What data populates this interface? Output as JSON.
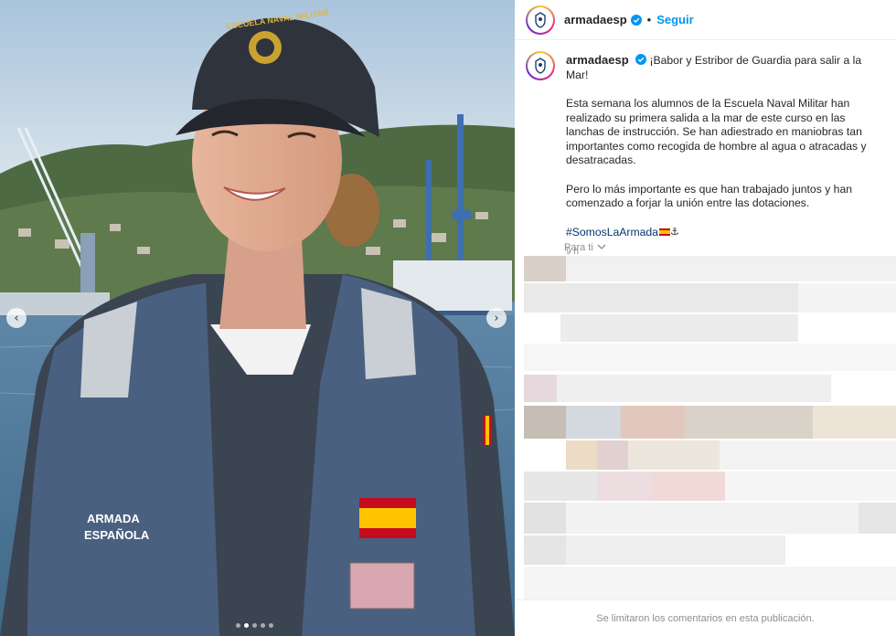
{
  "post": {
    "username": "armadaesp",
    "follow_label": "Seguir",
    "separator": "•",
    "caption_title": "¡Babor y Estribor de Guardia para salir a la Mar!",
    "caption_p1": "Esta semana los alumnos de la Escuela Naval Militar han realizado su primera salida a la mar de este curso en las lanchas de instrucción. Se han adiestrado en maniobras tan importantes como recogida de hombre al agua o atracadas y desatracadas.",
    "caption_p2": "Pero lo más importante es que han trabajado juntos y han comenzado a forjar la unión entre las dotaciones.",
    "hashtag": "#SomosLaArmada",
    "time": "9 h",
    "for_you_label": "Para ti",
    "comments_limited": "Se limitaron los comentarios en esta publicación."
  },
  "photo": {
    "cap_text": "ESCUELA NAVAL MILITAR",
    "vest_text_1": "ARMADA",
    "vest_text_2": "ESPAÑOLA",
    "carousel_count": 5,
    "carousel_active": 2
  },
  "icons": {
    "verified": "verified-badge-icon",
    "chevron": "chevron-down-icon",
    "prev": "chevron-left-icon",
    "next": "chevron-right-icon"
  },
  "colors": {
    "link_blue": "#0095f6",
    "hashtag_blue": "#00376b",
    "muted": "#8e8e8e"
  }
}
